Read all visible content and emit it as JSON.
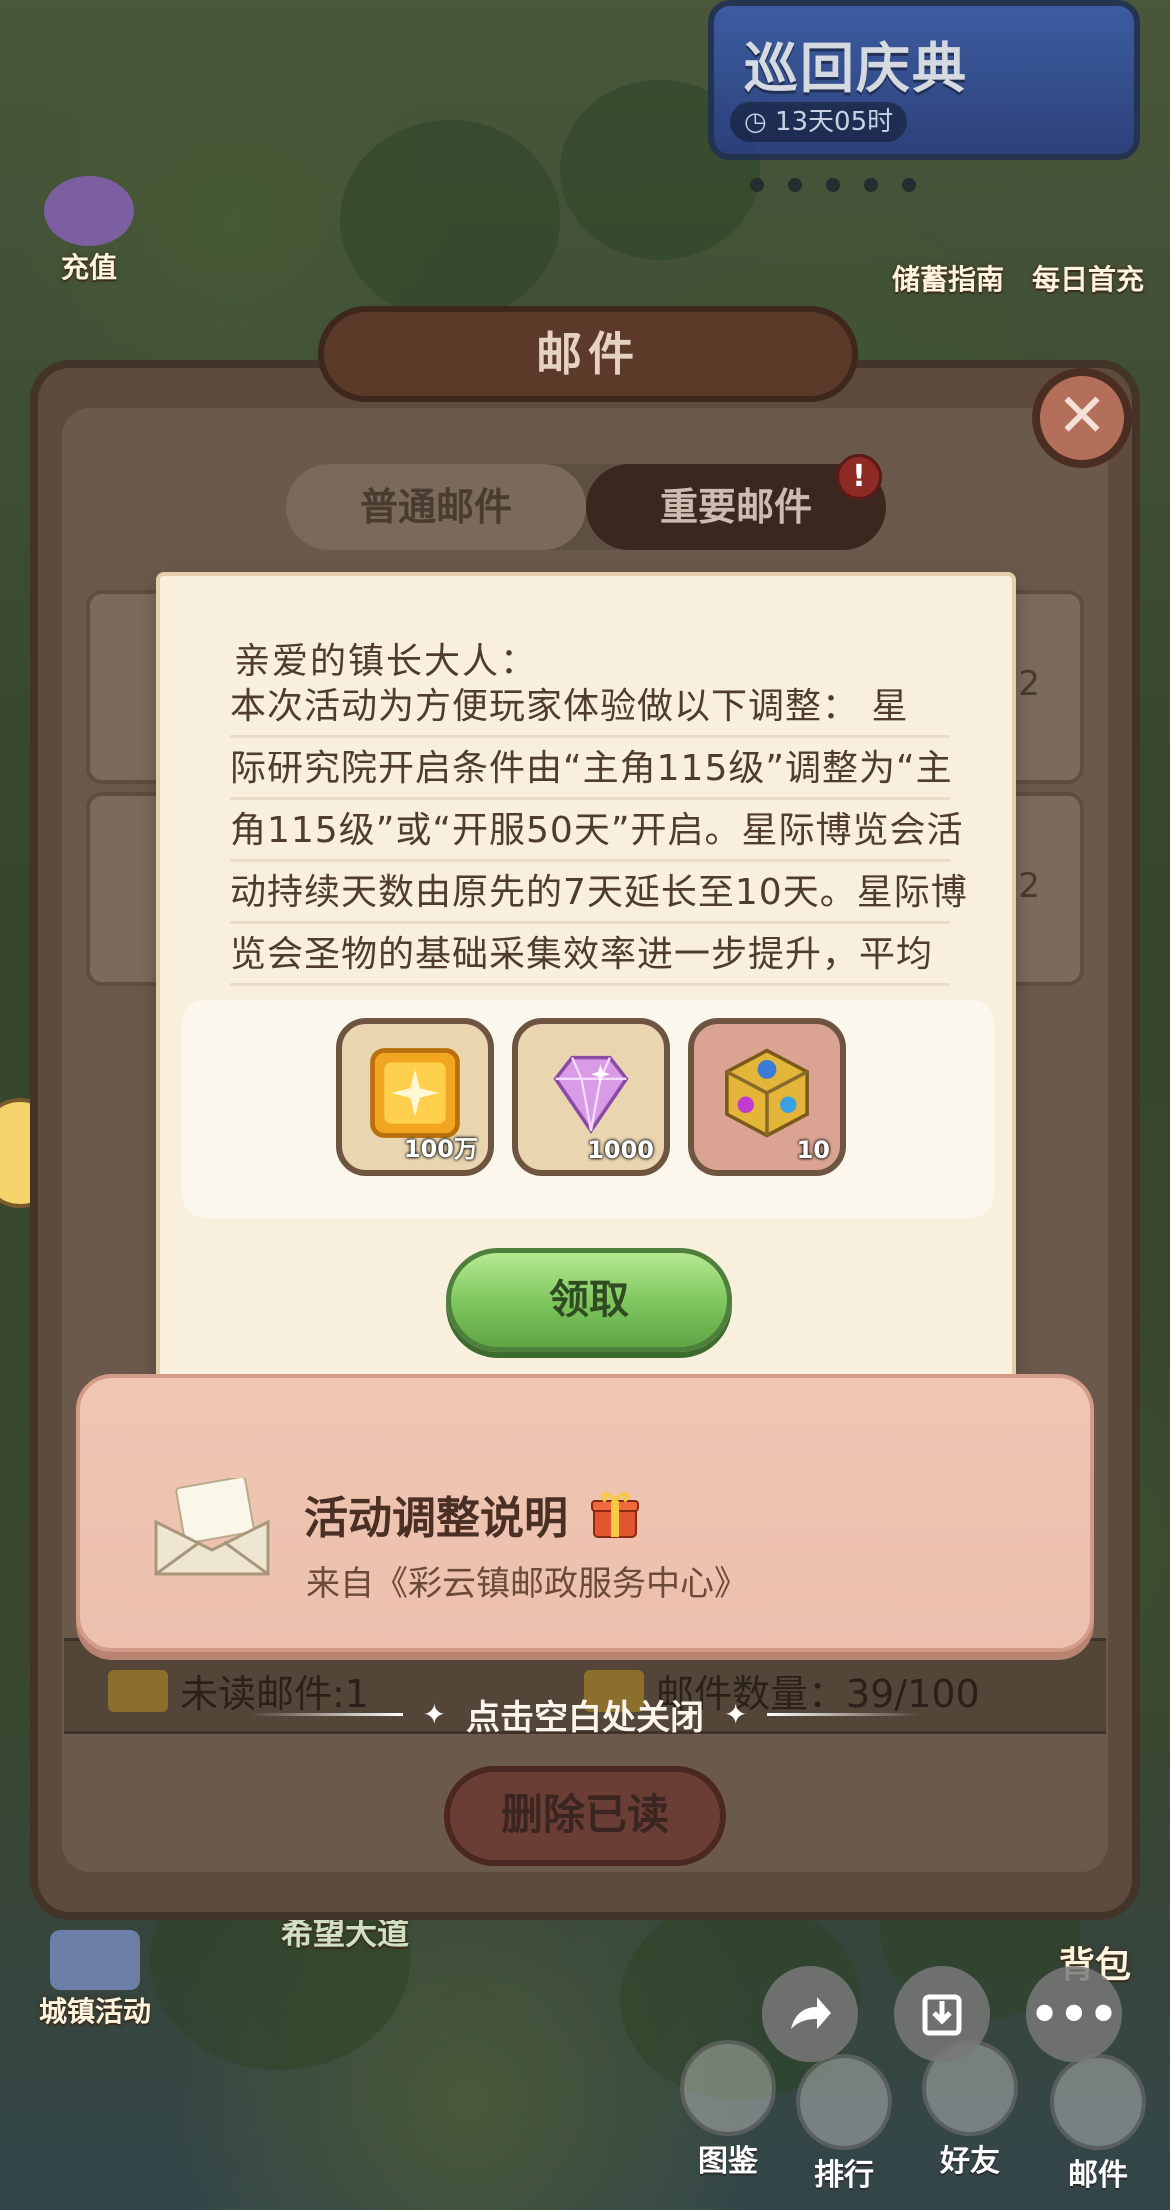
{
  "background": {
    "event_banner": {
      "title": "巡回庆典",
      "timer": "13天05时"
    },
    "left_buttons": [
      {
        "label": "充值",
        "icon": "gem-pile-icon"
      },
      {
        "label": "城镇活动",
        "icon": "town-event-icon"
      }
    ],
    "right_buttons": [
      {
        "label": "储蓄指南",
        "icon": "savings-guide-icon"
      },
      {
        "label": "每日首充",
        "icon": "daily-first-recharge-icon"
      }
    ],
    "bottom_bar": [
      {
        "label": "图鉴",
        "icon": "book-icon"
      },
      {
        "label": "排行",
        "icon": "ranking-icon"
      },
      {
        "label": "好友",
        "icon": "friends-icon"
      },
      {
        "label": "邮件",
        "icon": "mail-icon"
      }
    ],
    "partial_labels": {
      "bag": "背包",
      "tag": "希望大道"
    }
  },
  "mail_window": {
    "title": "邮件",
    "tabs": [
      {
        "label": "普通邮件",
        "active": false
      },
      {
        "label": "重要邮件",
        "active": true
      }
    ],
    "tab_badge": "!",
    "row_badge": "!",
    "row_numbers": [
      "2",
      "2"
    ],
    "unread_label": "未读邮件:1",
    "count_label": "邮件数量：39/100",
    "delete_button": "删除已读",
    "close_hint": "点击空白处关闭"
  },
  "letter": {
    "greeting": "亲爱的镇长大人：",
    "lines": [
      "本次活动为方便玩家体验做以下调整： 星",
      "际研究院开启条件由“主角115级”调整为“主",
      "角115级”或“开服50天”开启。星际博览会活",
      "动持续天数由原先的7天延长至10天。星际博",
      "览会圣物的基础采集效率进一步提升，平均"
    ],
    "rewards": [
      {
        "icon": "gold-cube-icon",
        "quantity": "100万",
        "frame": "tan"
      },
      {
        "icon": "diamond-icon",
        "quantity": "1000",
        "frame": "tan"
      },
      {
        "icon": "mystery-cube-icon",
        "quantity": "10",
        "frame": "pink"
      }
    ],
    "claim_button": "领取"
  },
  "envelope": {
    "title": "活动调整说明",
    "sender": "来自《彩云镇邮政服务中心》"
  },
  "system_buttons": [
    {
      "icon": "share-icon"
    },
    {
      "icon": "download-icon"
    },
    {
      "icon": "more-icon"
    }
  ]
}
